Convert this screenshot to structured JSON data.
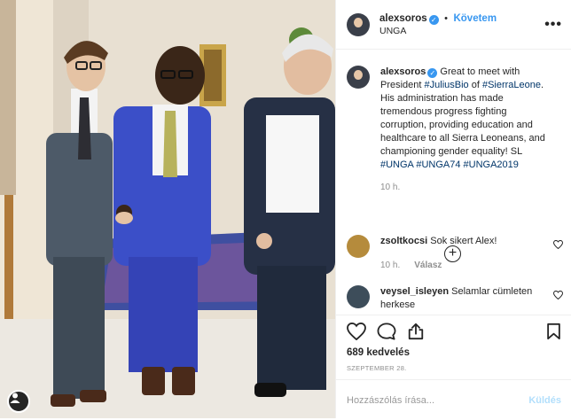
{
  "header": {
    "username": "alexsoros",
    "separator": "•",
    "follow_label": "Követem",
    "location": "UNGA",
    "more_label": "•••"
  },
  "caption": {
    "username": "alexsoros",
    "text_before_1": " Great to meet with President ",
    "tag_1": "#JuliusBio",
    "text_between": " of ",
    "tag_2": "#SierraLeone",
    "text_after": ". His administration has made tremendous progress fighting corruption, providing education and healthcare to all Sierra Leoneans, and championing gender equality! ",
    "flag": "SL",
    "hashtags": "#UNGA #UNGA74 #UNGA2019",
    "time": "10 h."
  },
  "comments": [
    {
      "username": "zsoltkocsi",
      "text": "Sok sikert Alex!",
      "time": "10 h.",
      "reply": "Válasz",
      "avatar_color": "#b58b3c"
    },
    {
      "username": "veysel_isleyen",
      "text": "Selamlar cümleten herkese",
      "avatar_color": "#3d4d5a"
    }
  ],
  "actions": {
    "likes": "689 kedvelés",
    "date": "SZEPTEMBER 28."
  },
  "composer": {
    "placeholder": "Hozzászólás írása...",
    "send_label": "Küldés"
  },
  "icons": {
    "heart": "heart-icon",
    "comment": "comment-icon",
    "share": "share-icon",
    "bookmark": "bookmark-icon",
    "load_more": "plus-circle-icon",
    "profile": "profile-icon",
    "verified": "verified-badge-icon"
  },
  "colors": {
    "accent": "#3897f0",
    "hashtag": "#003569",
    "muted": "#8e8e8e",
    "border": "#efefef"
  }
}
